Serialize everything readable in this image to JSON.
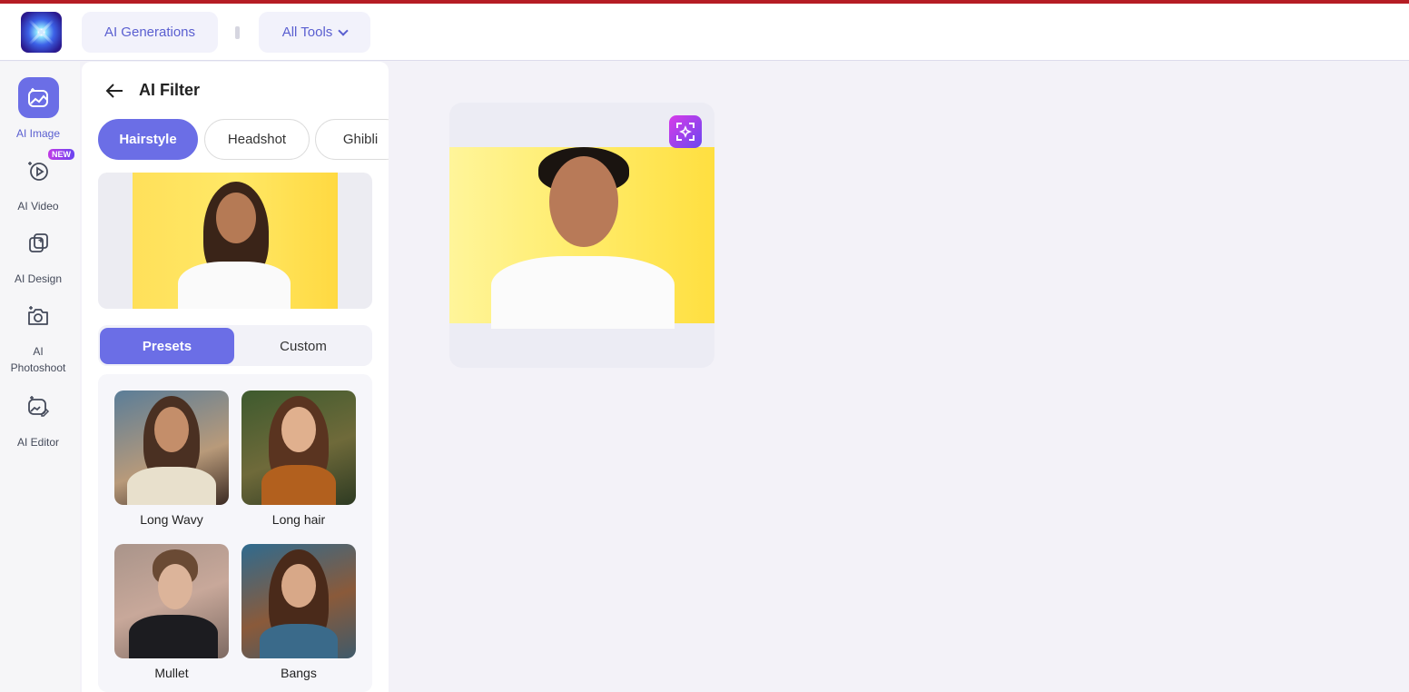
{
  "header": {
    "ai_generations": "AI Generations",
    "all_tools": "All Tools"
  },
  "nav": {
    "items": [
      {
        "label": "AI Image"
      },
      {
        "label": "AI Video",
        "badge": "NEW"
      },
      {
        "label": "AI Design"
      },
      {
        "label": "AI\nPhotoshoot"
      },
      {
        "label": "AI Editor"
      }
    ]
  },
  "panel": {
    "title": "AI Filter",
    "tabs": [
      "Hairstyle",
      "Headshot",
      "Ghibli"
    ],
    "segments": {
      "presets": "Presets",
      "custom": "Custom"
    },
    "presets": [
      {
        "label": "Long Wavy"
      },
      {
        "label": "Long hair"
      },
      {
        "label": "Mullet"
      },
      {
        "label": "Bangs"
      }
    ]
  },
  "colors": {
    "accent": "#6b6ee6",
    "accent_text": "#5a5fd0",
    "topline": "#b51c24"
  }
}
